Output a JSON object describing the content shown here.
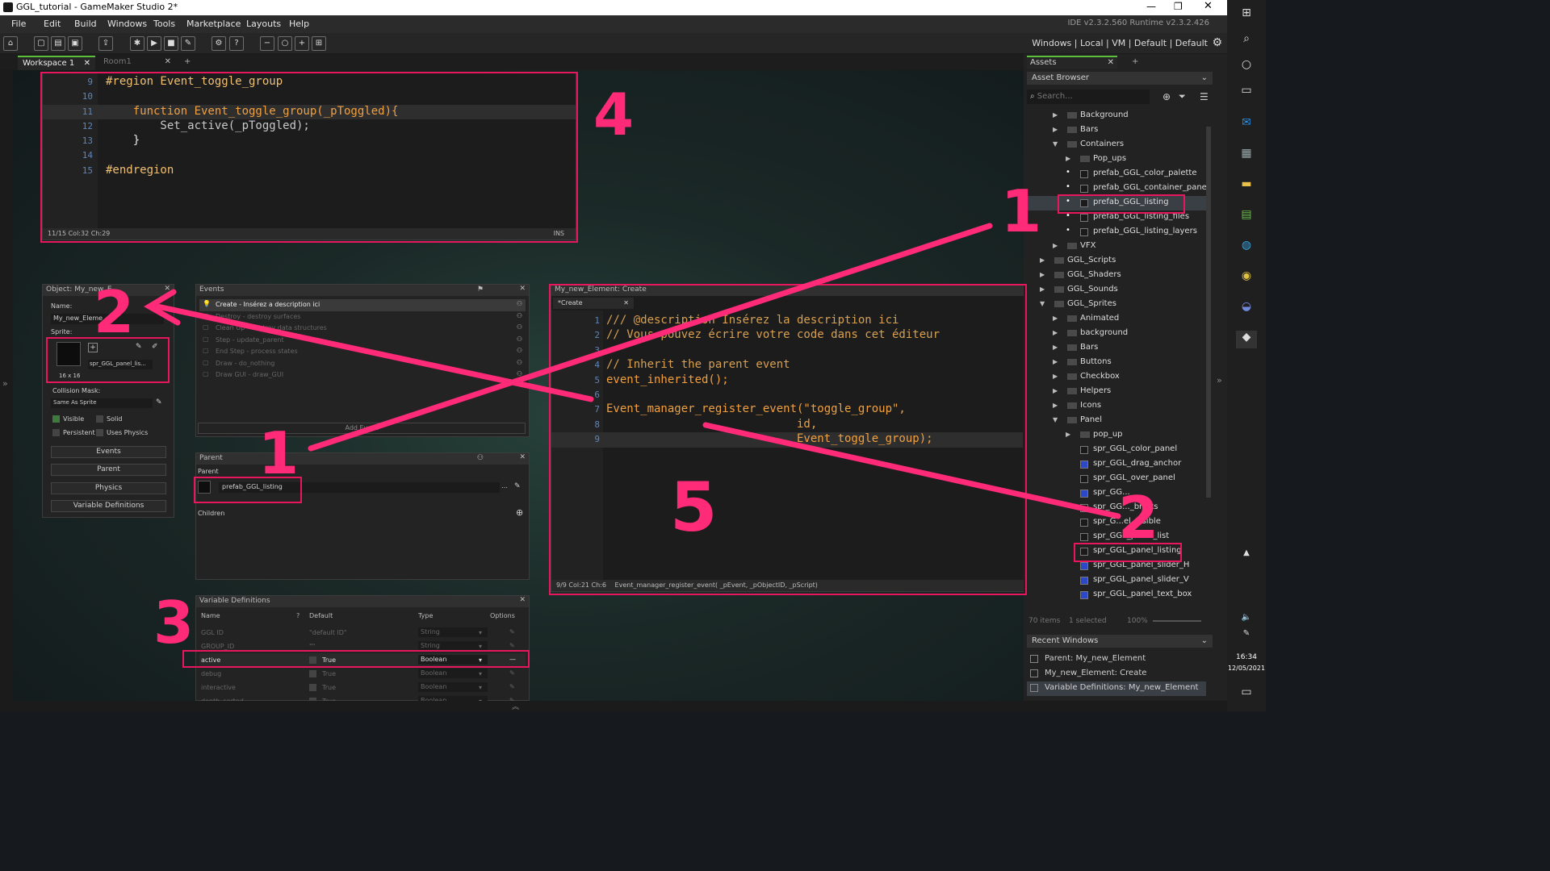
{
  "title": "GGL_tutorial - GameMaker Studio 2*",
  "menu": [
    "File",
    "Edit",
    "Build",
    "Windows",
    "Tools",
    "Marketplace",
    "Layouts",
    "Help"
  ],
  "version": "IDE v2.3.2.560  Runtime v2.3.2.426",
  "targets": "Windows  |  Local  |  VM  |  Default  |  Default",
  "tabs": {
    "workspace": "Workspace 1",
    "room": "Room1"
  },
  "region_editor": {
    "lines": [
      {
        "n": "9",
        "code": "#region Event_toggle_group"
      },
      {
        "n": "10",
        "code": ""
      },
      {
        "n": "11",
        "code": "    function Event_toggle_group(_pToggled){"
      },
      {
        "n": "12",
        "code": "        Set_active(_pToggled);"
      },
      {
        "n": "13",
        "code": "    }"
      },
      {
        "n": "14",
        "code": ""
      },
      {
        "n": "15",
        "code": "#endregion"
      }
    ],
    "status": "11/15 Col:32 Ch:29",
    "mode": "INS"
  },
  "object_panel": {
    "header": "Object: My_new_E...",
    "name_label": "Name:",
    "name_value": "My_new_Eleme...",
    "sprite_label": "Sprite:",
    "sprite_value": "spr_GGL_panel_lis...",
    "sprite_size": "16 x 16",
    "collision_label": "Collision Mask:",
    "collision_value": "Same As Sprite",
    "visible": "Visible",
    "solid": "Solid",
    "persistent": "Persistent",
    "uses_physics": "Uses Physics",
    "events_btn": "Events",
    "parent_btn": "Parent",
    "physics_btn": "Physics",
    "variables_btn": "Variable Definitions"
  },
  "events_panel": {
    "header": "Events",
    "items": [
      "Create - Insérez  a description ici",
      "Destroy - destroy surfaces",
      "Clean Up - destroy data structures",
      "Step - update_parent",
      "End Step - process states",
      "Draw - do_nothing",
      "Draw GUI - draw_GUI"
    ],
    "add": "Add Event"
  },
  "parent_panel": {
    "header": "Parent",
    "parent_label": "Parent",
    "parent_value": "prefab_GGL_listing",
    "children_label": "Children"
  },
  "vardef_panel": {
    "header": "Variable Definitions",
    "columns": [
      "Name",
      "Default",
      "Type",
      "Options"
    ],
    "rows": [
      {
        "name": "GGL ID",
        "default": "\"default ID\"",
        "type": "String"
      },
      {
        "name": "GROUP_ID",
        "default": "\"\"",
        "type": "String"
      },
      {
        "name": "active",
        "default": "True",
        "type": "Boolean"
      },
      {
        "name": "debug",
        "default": "True",
        "type": "Boolean"
      },
      {
        "name": "interactive",
        "default": "True",
        "type": "Boolean"
      },
      {
        "name": "depth_sorted",
        "default": "True",
        "type": "Boolean"
      }
    ]
  },
  "create_editor": {
    "header": "My_new_Element: Create",
    "tab": "*Create",
    "lines": [
      {
        "n": "1",
        "code": "/// @description Insérez la description ici"
      },
      {
        "n": "2",
        "code": "// Vous pouvez écrire votre code dans cet éditeur"
      },
      {
        "n": "3",
        "code": ""
      },
      {
        "n": "4",
        "code": "// Inherit the parent event"
      },
      {
        "n": "5",
        "code": "event_inherited();"
      },
      {
        "n": "6",
        "code": ""
      },
      {
        "n": "7",
        "code": "Event_manager_register_event(\"toggle_group\","
      },
      {
        "n": "8",
        "code": "                            id,"
      },
      {
        "n": "9",
        "code": "                            Event_toggle_group);"
      }
    ],
    "status": "9/9 Col:21 Ch:6",
    "hint": "Event_manager_register_event( _pEvent, _pObjectID, _pScript)"
  },
  "assets": {
    "tab": "Assets",
    "browser": "Asset Browser",
    "search_placeholder": "Search...",
    "tree": [
      {
        "label": "Background",
        "indent": 2,
        "kind": "folder",
        "arrow": "▶"
      },
      {
        "label": "Bars",
        "indent": 2,
        "kind": "folder",
        "arrow": "▶"
      },
      {
        "label": "Containers",
        "indent": 2,
        "kind": "folder",
        "arrow": "▼"
      },
      {
        "label": "Pop_ups",
        "indent": 3,
        "kind": "folder",
        "arrow": "▶"
      },
      {
        "label": "prefab_GGL_color_palette",
        "indent": 3,
        "kind": "object",
        "arrow": ""
      },
      {
        "label": "prefab_GGL_container_panel",
        "indent": 3,
        "kind": "object",
        "arrow": ""
      },
      {
        "label": "prefab_GGL_listing",
        "indent": 3,
        "kind": "object",
        "arrow": ""
      },
      {
        "label": "prefab_GGL_listing_files",
        "indent": 3,
        "kind": "object",
        "arrow": ""
      },
      {
        "label": "prefab_GGL_listing_layers",
        "indent": 3,
        "kind": "object",
        "arrow": ""
      },
      {
        "label": "VFX",
        "indent": 2,
        "kind": "folder",
        "arrow": "▶"
      },
      {
        "label": "GGL_Scripts",
        "indent": 1,
        "kind": "folder",
        "arrow": "▶"
      },
      {
        "label": "GGL_Shaders",
        "indent": 1,
        "kind": "folder",
        "arrow": "▶"
      },
      {
        "label": "GGL_Sounds",
        "indent": 1,
        "kind": "folder",
        "arrow": "▶"
      },
      {
        "label": "GGL_Sprites",
        "indent": 1,
        "kind": "folder",
        "arrow": "▼"
      },
      {
        "label": "Animated",
        "indent": 2,
        "kind": "folder",
        "arrow": "▶"
      },
      {
        "label": "background",
        "indent": 2,
        "kind": "folder",
        "arrow": "▶"
      },
      {
        "label": "Bars",
        "indent": 2,
        "kind": "folder",
        "arrow": "▶"
      },
      {
        "label": "Buttons",
        "indent": 2,
        "kind": "folder",
        "arrow": "▶"
      },
      {
        "label": "Checkbox",
        "indent": 2,
        "kind": "folder",
        "arrow": "▶"
      },
      {
        "label": "Helpers",
        "indent": 2,
        "kind": "folder",
        "arrow": "▶"
      },
      {
        "label": "Icons",
        "indent": 2,
        "kind": "folder",
        "arrow": "▶"
      },
      {
        "label": "Panel",
        "indent": 2,
        "kind": "folder",
        "arrow": "▼"
      },
      {
        "label": "pop_up",
        "indent": 3,
        "kind": "folder",
        "arrow": "▶"
      },
      {
        "label": "spr_GGL_color_panel",
        "indent": 3,
        "kind": "sprite",
        "arrow": ""
      },
      {
        "label": "spr_GGL_drag_anchor",
        "indent": 3,
        "kind": "sprite",
        "arrow": ""
      },
      {
        "label": "spr_GGL_over_panel",
        "indent": 3,
        "kind": "sprite",
        "arrow": ""
      },
      {
        "label": "spr_GG...",
        "indent": 3,
        "kind": "sprite",
        "arrow": ""
      },
      {
        "label": "spr_GG..._bricks",
        "indent": 3,
        "kind": "sprite",
        "arrow": ""
      },
      {
        "label": "spr_G...el_visible",
        "indent": 3,
        "kind": "sprite",
        "arrow": ""
      },
      {
        "label": "spr_GGL_panel_list",
        "indent": 3,
        "kind": "sprite",
        "arrow": ""
      },
      {
        "label": "spr_GGL_panel_listing",
        "indent": 3,
        "kind": "sprite",
        "arrow": ""
      },
      {
        "label": "spr_GGL_panel_slider_H",
        "indent": 3,
        "kind": "sprite",
        "arrow": ""
      },
      {
        "label": "spr_GGL_panel_slider_V",
        "indent": 3,
        "kind": "sprite",
        "arrow": ""
      },
      {
        "label": "spr_GGL_panel_text_box",
        "indent": 3,
        "kind": "sprite",
        "arrow": ""
      }
    ],
    "items_count": "70 items",
    "selected": "1 selected",
    "zoom": "100%"
  },
  "recent": {
    "header": "Recent Windows",
    "items": [
      "Parent: My_new_Element",
      "My_new_Element: Create",
      "Variable Definitions: My_new_Element"
    ]
  },
  "clock": {
    "time": "16:34",
    "date": "12/05/2021"
  },
  "annotations": {
    "n1a": "1",
    "n1b": "1",
    "n2a": "2",
    "n2b": "2",
    "n3": "3",
    "n4": "4",
    "n5": "5"
  },
  "colors": {
    "annotation": "#e8175d",
    "accent_blue": "#5a86c0"
  }
}
